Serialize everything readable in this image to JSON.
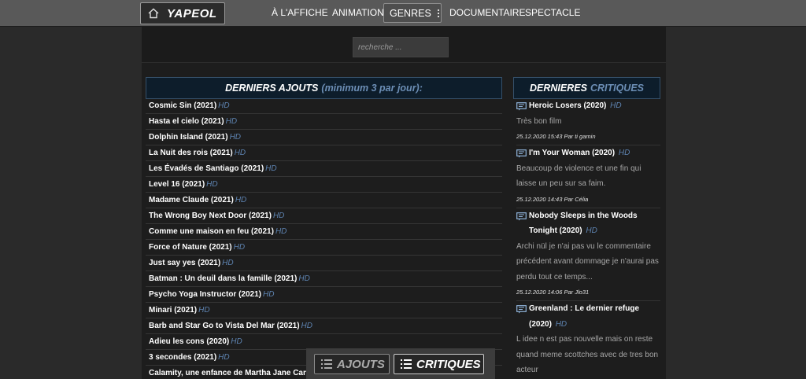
{
  "brand": {
    "logo_text": "YAPEOL"
  },
  "nav": {
    "a_laffiche": "À L'AFFICHE",
    "animation": "ANIMATION",
    "genres": "GENRES",
    "documentaire": "DOCUMENTAIRE",
    "spectacle": "SPECTACLE"
  },
  "search": {
    "placeholder": "recherche ..."
  },
  "latest": {
    "title": "DERNIERS AJOUTS",
    "subtitle": "(minimum 3 par jour):",
    "quality_label": "HD",
    "items": [
      "Cosmic Sin (2021)",
      "Hasta el cielo (2021)",
      "Dolphin Island (2021)",
      "La Nuit des rois (2021)",
      "Les Évadés de Santiago (2021)",
      "Level 16 (2021)",
      "Madame Claude (2021)",
      "The Wrong Boy Next Door (2021)",
      "Comme une maison en feu (2021)",
      "Force of Nature (2021)",
      "Just say yes (2021)",
      "Batman : Un deuil dans la famille (2021)",
      "Psycho Yoga Instructor (2021)",
      "Minari (2021)",
      "Barb and Star Go to Vista Del Mar (2021)",
      "Adieu les cons (2020)",
      "3 secondes (2021)",
      "Calamity, une enfance de Martha Jane Canna"
    ]
  },
  "critiques": {
    "title_a": "DERNIERES",
    "title_b": "CRITIQUES",
    "quality_label": "HD",
    "items": [
      {
        "title": "Heroic Losers (2020)",
        "body": "Très bon film",
        "meta": "25.12.2020 15:43 Par ti gamin"
      },
      {
        "title": "I'm Your Woman (2020)",
        "body": "Beaucoup de violence et une fin qui laisse un peu sur sa faim.",
        "meta": "25.12.2020 14:43 Par Célia"
      },
      {
        "title": "Nobody Sleeps in the Woods Tonight (2020)",
        "body": "Archi nül je n'ai pas vu le commentaire précédent avant dommage je n'aurai pas perdu tout ce temps...",
        "meta": "25.12.2020 14:06 Par Jlo31"
      },
      {
        "title": "Greenland : Le dernier refuge (2020)",
        "body": "L idee n est pas nouvelle mais on reste quand meme scottches avec de tres bon acteur",
        "meta": ""
      }
    ]
  },
  "bottom": {
    "ajouts": "AJOUTS",
    "critiques": "CRITIQUES"
  }
}
